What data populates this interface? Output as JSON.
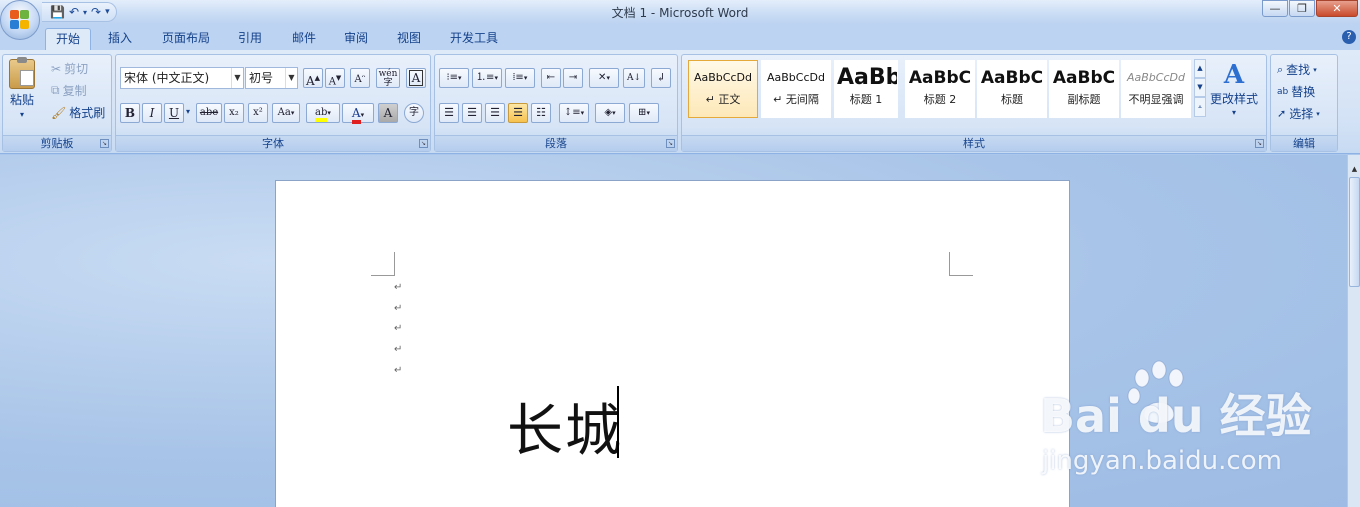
{
  "window": {
    "title": "文档 1 - Microsoft Word",
    "controls": [
      "—",
      "❐",
      "✕"
    ]
  },
  "qat": {
    "save": "💾",
    "undo": "↶",
    "redo": "↷",
    "customize": "▾"
  },
  "tabs": [
    "开始",
    "插入",
    "页面布局",
    "引用",
    "邮件",
    "审阅",
    "视图",
    "开发工具"
  ],
  "clipboard": {
    "group_name": "剪贴板",
    "paste": "粘贴",
    "cut": "剪切",
    "copy": "复制",
    "format_painter": "格式刷"
  },
  "font": {
    "group_name": "字体",
    "font_name": "宋体 (中文正文)",
    "font_size": "初号",
    "grow": "A",
    "shrink": "A",
    "bold": "B",
    "italic": "I",
    "underline": "U",
    "strike": "abe",
    "subscript": "x₂",
    "superscript": "x²",
    "change_case": "Aa",
    "highlight": "ab",
    "font_color": "A",
    "char_shading": "A",
    "enclose": "字",
    "phonetic": "wén",
    "border": "A"
  },
  "paragraph": {
    "group_name": "段落"
  },
  "styles": {
    "group_name": "样式",
    "items": [
      {
        "sample": "AaBbCcDd",
        "name": "↵ 正文"
      },
      {
        "sample": "AaBbCcDd",
        "name": "↵ 无间隔"
      },
      {
        "sample": "AaBb",
        "name": "标题 1"
      },
      {
        "sample": "AaBbC",
        "name": "标题 2"
      },
      {
        "sample": "AaBbC",
        "name": "标题"
      },
      {
        "sample": "AaBbC",
        "name": "副标题"
      },
      {
        "sample": "AaBbCcDd",
        "name": "不明显强调"
      }
    ],
    "change_styles": "更改样式"
  },
  "editing": {
    "group_name": "编辑",
    "find": "查找",
    "replace": "替换",
    "select": "选择"
  },
  "document": {
    "text": "长城",
    "marks": [
      "↵",
      "↵",
      "↵",
      "↵",
      "↵"
    ]
  },
  "watermark": {
    "logo": "Bai du 经验",
    "url": "jingyan.baidu.com"
  },
  "colors": {
    "accent": "#15428b",
    "highlight": "#ffff00",
    "font_color": "#e02020"
  }
}
